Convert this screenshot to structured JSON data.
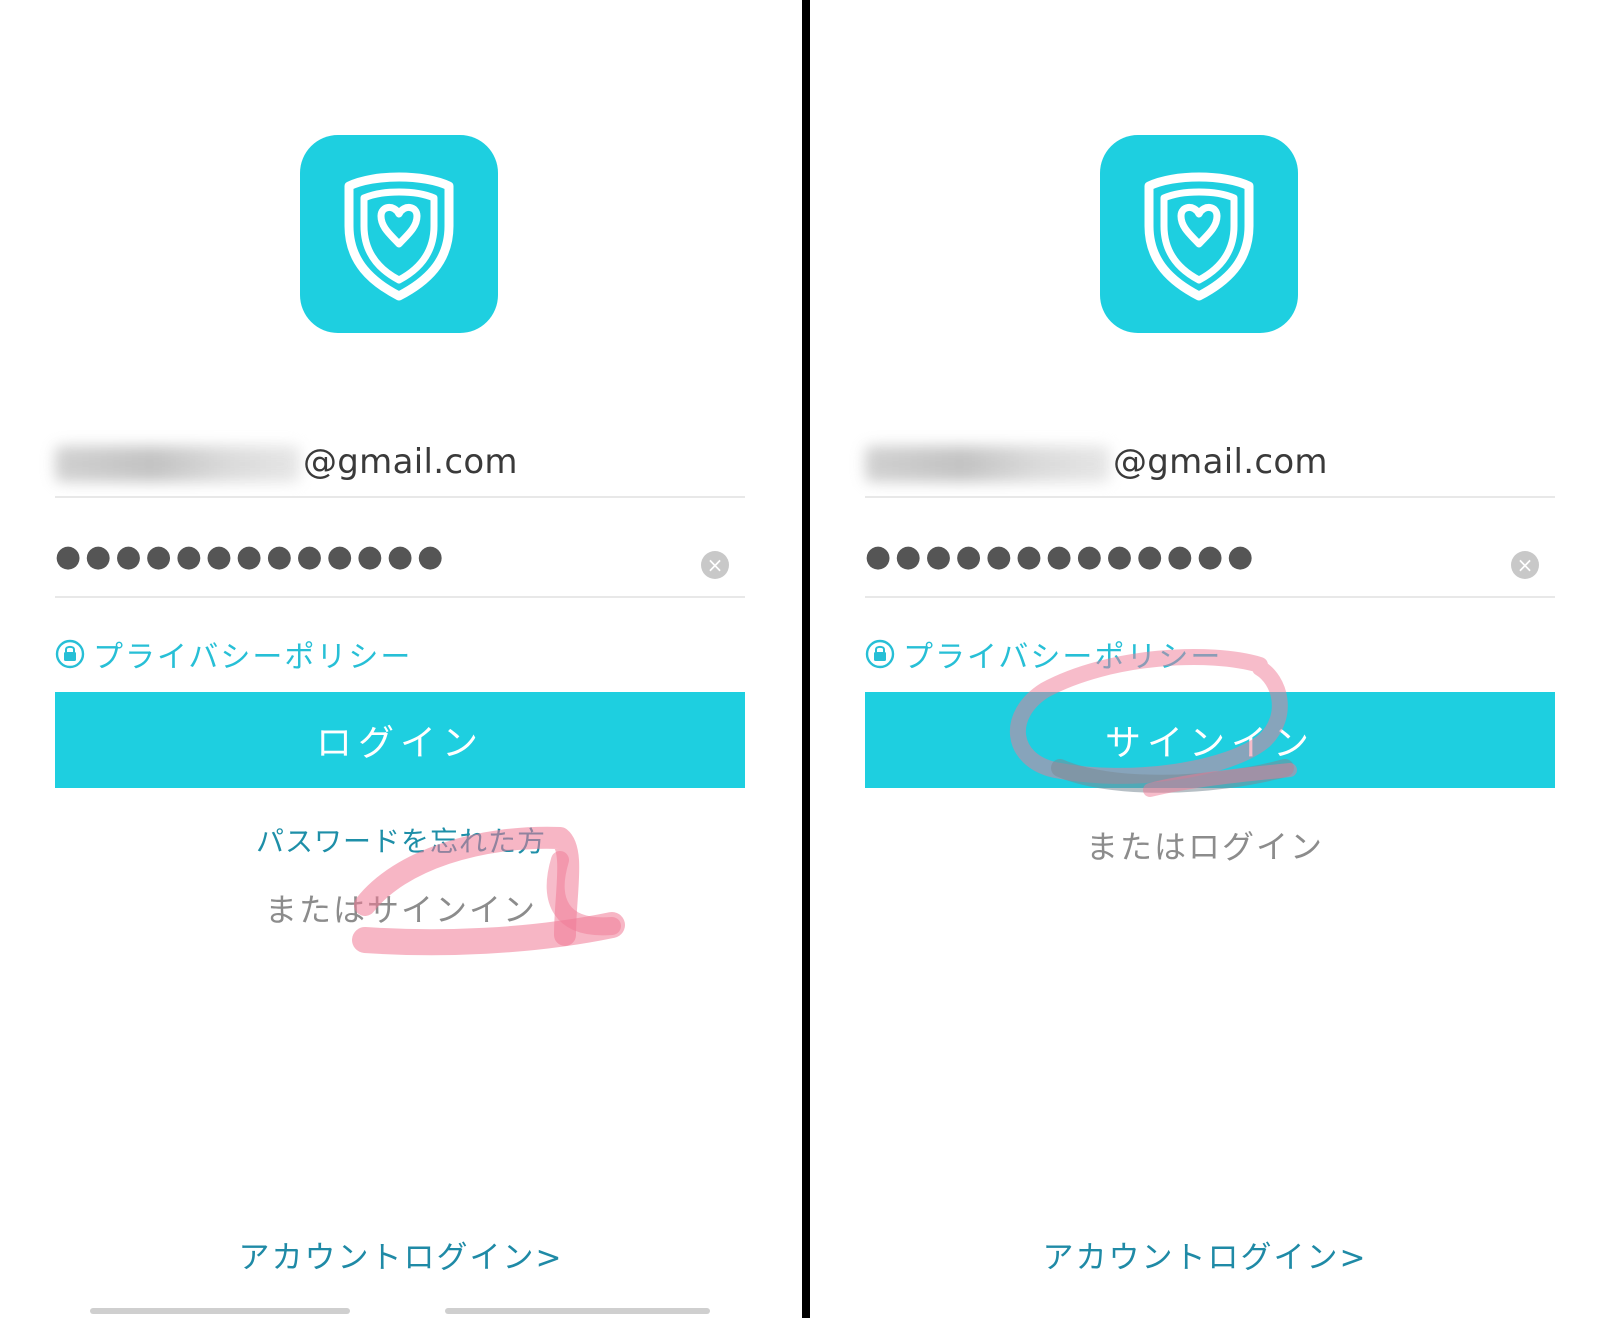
{
  "left": {
    "email_suffix": "@gmail.com",
    "password_mask": "●●●●●●●●●●●●●",
    "privacy_label": "プライバシーポリシー",
    "primary_button": "ログイン",
    "forgot_label": "パスワードを忘れた方",
    "or_label": "またはサインイン",
    "account_login": "アカウントログイン>"
  },
  "right": {
    "email_suffix": "@gmail.com",
    "password_mask": "●●●●●●●●●●●●●",
    "privacy_label": "プライバシーポリシー",
    "primary_button": "サインイン",
    "or_label": "またはログイン",
    "account_login": "アカウントログイン>"
  },
  "icons": {
    "app_logo": "shield-heart-icon",
    "lock": "lock-icon",
    "clear": "clear-icon"
  },
  "colors": {
    "accent": "#1ecfe0",
    "link": "#27bfd6",
    "dark_link": "#1f8aa6",
    "marker_pink": "#f07a96",
    "marker_grey": "#7a8a96"
  }
}
